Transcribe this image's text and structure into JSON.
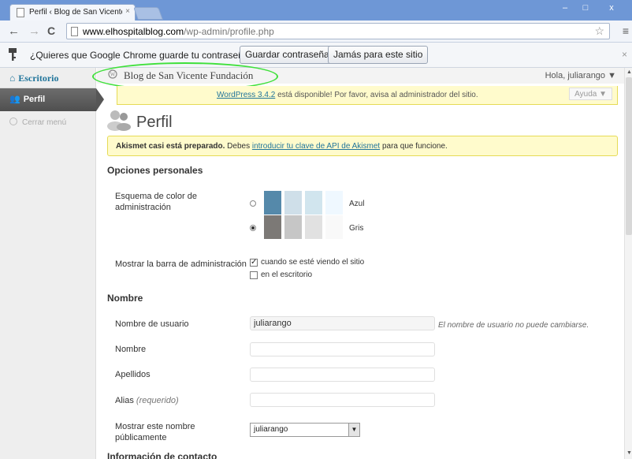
{
  "browser": {
    "tab_title": "Perfil ‹ Blog de San Vicente Fu",
    "tab_close": "×",
    "window_minimize": "–",
    "window_maximize": "□",
    "window_close": "x",
    "back": "←",
    "forward": "→",
    "reload": "C",
    "url_host": "www.elhospitalblog.com",
    "url_path": "/wp-admin/profile.php",
    "star": "☆",
    "menu": "≡"
  },
  "infobar": {
    "text": "¿Quieres que Google Chrome guarde tu contraseña?",
    "save_button": "Guardar contraseña",
    "never_button": "Jamás para este sitio",
    "close": "×"
  },
  "sidebar": {
    "home_icon": "⌂",
    "home": "Escritorio",
    "profile_icon": "👥",
    "profile": "Perfil",
    "collapse": "Cerrar menú"
  },
  "adminbar": {
    "site_name": "Blog de San Vicente Fundación",
    "howdy": "Hola, juliarango ▼"
  },
  "update_nag": {
    "link": "WordPress 3.4.2",
    "text": " está disponible! Por favor, avisa al administrador del sitio.",
    "help": "Ayuda ▼"
  },
  "page": {
    "title": "Perfil"
  },
  "akismet": {
    "bold": "Akismet casi está preparado.",
    "text1": " Debes ",
    "link": "introducir tu clave de API de Akismet",
    "text2": " para que funcione."
  },
  "personal_options": {
    "heading": "Opciones personales",
    "color_scheme_label": "Esquema de color de administración",
    "schemes": [
      {
        "name": "Azul",
        "selected": false,
        "colors": [
          "#5589aa",
          "#cfdfe9",
          "#d1e5ee",
          "#eff8ff"
        ]
      },
      {
        "name": "Gris",
        "selected": true,
        "colors": [
          "#7c7976",
          "#c6c6c6",
          "#e1e1e1",
          "#f9f9f9"
        ]
      }
    ],
    "toolbar_label": "Mostrar la barra de administración",
    "toolbar_site": "cuando se esté viendo el sitio",
    "toolbar_site_checked": true,
    "toolbar_dashboard": "en el escritorio",
    "toolbar_dashboard_checked": false,
    "check_mark": "✓"
  },
  "name": {
    "heading": "Nombre",
    "username_label": "Nombre de usuario",
    "username_value": "juliarango",
    "username_desc": "El nombre de usuario no puede cambiarse.",
    "first_name_label": "Nombre",
    "first_name_value": "",
    "last_name_label": "Apellidos",
    "last_name_value": "",
    "nickname_label": "Alias",
    "nickname_required": "(requerido)",
    "nickname_value": "",
    "display_label": "Mostrar este nombre públicamente",
    "display_value": "juliarango",
    "select_arrow": "▼"
  },
  "contact": {
    "heading": "Información de contacto"
  }
}
